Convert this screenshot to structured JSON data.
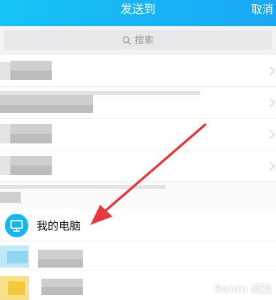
{
  "header": {
    "title": "发送到",
    "cancel_label": "取消",
    "color": "#17b5f6"
  },
  "search": {
    "placeholder": "搜索",
    "icon": "search-icon"
  },
  "list": {
    "rows": [
      {
        "label": "",
        "blurred": true,
        "has_chevron": true
      },
      {
        "label": "",
        "blurred": true,
        "has_chevron": true
      },
      {
        "label": "",
        "blurred": true,
        "has_chevron": true
      },
      {
        "label": "",
        "blurred": true,
        "has_chevron": true
      }
    ],
    "my_computer": {
      "label": "我的电脑",
      "icon": "monitor-icon",
      "icon_color": "#12b7f5"
    }
  },
  "annotation": {
    "arrow_color": "#e8373a"
  },
  "watermark": {
    "text": "Baidu 经验"
  }
}
